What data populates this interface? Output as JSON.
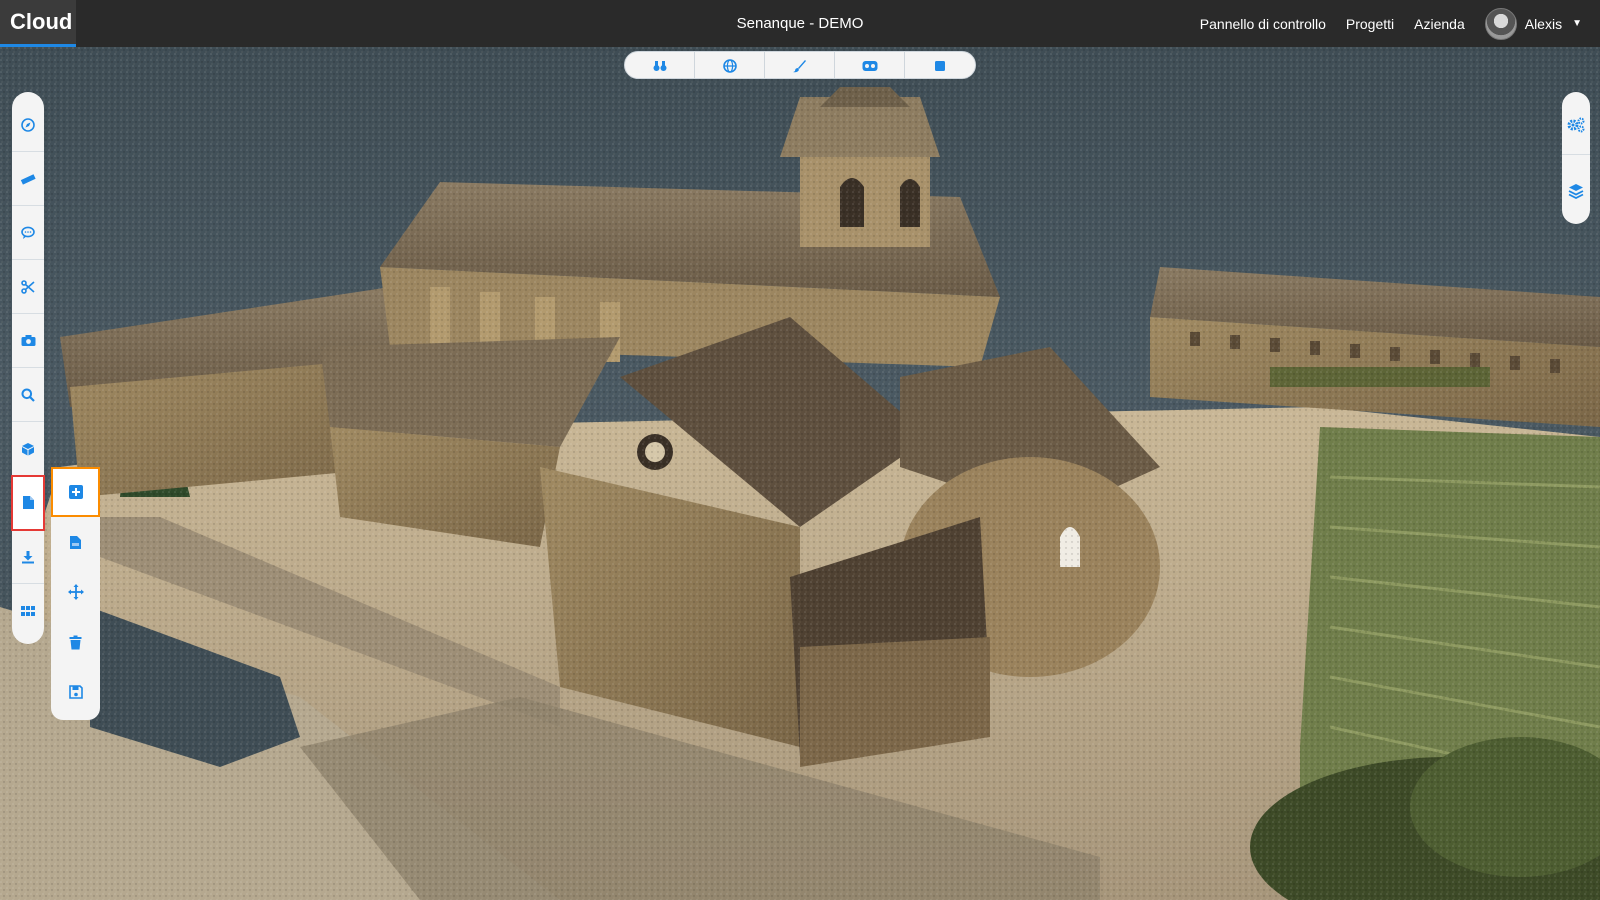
{
  "app": {
    "brand": "Cloud",
    "project_title": "Senanque - DEMO"
  },
  "nav": {
    "items": [
      "Pannello di controllo",
      "Progetti",
      "Azienda"
    ],
    "user_name": "Alexis"
  },
  "colors": {
    "accent": "#1e88e5",
    "active_outline": "#e53935",
    "highlight_outline": "#fb8c00",
    "topbar": "#2a2a2a"
  },
  "viewbar": {
    "icons": [
      "binoculars-icon",
      "globe-icon",
      "brush-icon",
      "vr-headset-icon",
      "square-icon"
    ]
  },
  "left_toolbar": {
    "icons": [
      "compass-icon",
      "ruler-icon",
      "comment-icon",
      "scissors-icon",
      "camera-icon",
      "search-icon",
      "cube-icon",
      "file-icon",
      "download-icon",
      "grid-icon"
    ],
    "active": "file-icon"
  },
  "sub_toolbar": {
    "icons": [
      "add-square-icon",
      "csv-file-icon",
      "move-icon",
      "trash-icon",
      "save-icon"
    ],
    "highlighted": "add-square-icon"
  },
  "right_toolbar": {
    "icons": [
      "settings-icon",
      "layers-icon"
    ]
  }
}
